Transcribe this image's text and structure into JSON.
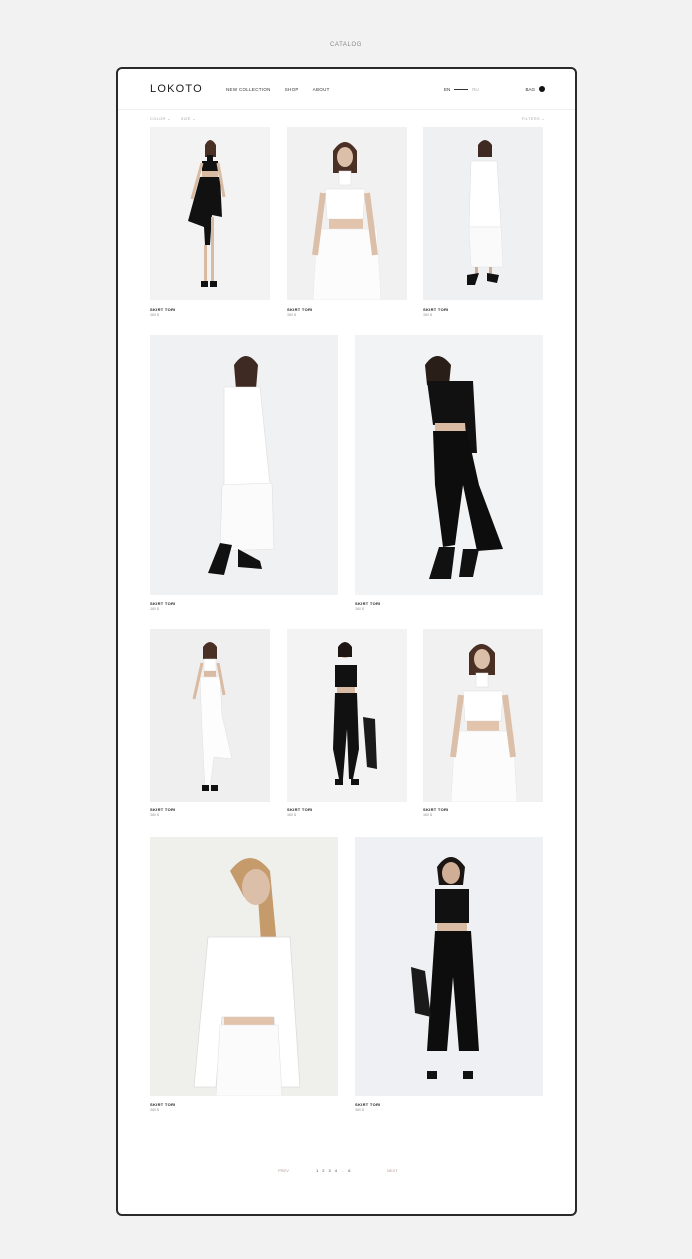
{
  "caption": "CATALOG",
  "header": {
    "logo": "LOKOTO",
    "nav": [
      "NEW COLLECTION",
      "SHOP",
      "ABOUT"
    ],
    "lang_active": "EN",
    "lang_alt": "RU",
    "bag_label": "BAG"
  },
  "filters": {
    "color": "COLOR ⌄",
    "size": "SIZE ⌄",
    "filters": "FILTERS ⌄"
  },
  "products": [
    {
      "name": "SKIRT TORI",
      "price": "380 $"
    },
    {
      "name": "SKIRT TORI",
      "price": "380 $"
    },
    {
      "name": "SKIRT TORI",
      "price": "380 $"
    },
    {
      "name": "SKIRT TORI",
      "price": "380 $"
    },
    {
      "name": "SKIRT TORI",
      "price": "380 $"
    },
    {
      "name": "SKIRT TORI",
      "price": "380 $"
    },
    {
      "name": "SKIRT TORI",
      "price": "380 $"
    },
    {
      "name": "SKIRT TORI",
      "price": "380 $"
    },
    {
      "name": "SKIRT TORI",
      "price": "380 $"
    },
    {
      "name": "SKIRT TORI",
      "price": "380 $"
    }
  ],
  "pagination": {
    "prev": "PREV",
    "pages": [
      "1",
      "2",
      "3",
      "4",
      "...",
      "6"
    ],
    "next": "NEXT"
  },
  "colors": {
    "background": "#f2f2f2",
    "frame_border": "#2a2a2a",
    "accent": "#111111"
  }
}
